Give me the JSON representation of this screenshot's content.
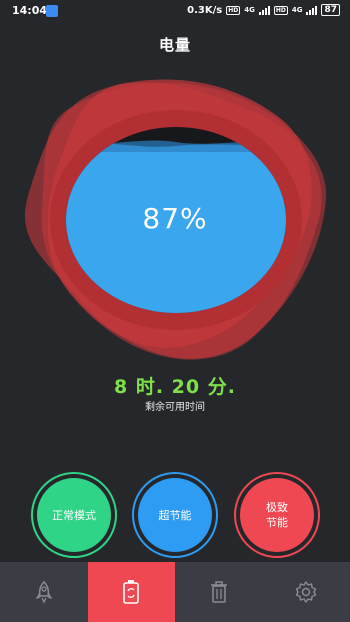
{
  "status_bar": {
    "time": "14:04",
    "speed": "0.3K/s",
    "network_1": "4G",
    "network_2": "4G",
    "hd_1": "HD",
    "hd_2": "HD",
    "battery": "87",
    "app_icon": "paper-plane-icon"
  },
  "header": {
    "title": "电量"
  },
  "battery": {
    "percent_text": "87%",
    "level": 0.87,
    "remaining_time": "8 时. 20 分.",
    "remaining_label": "剩余可用时间"
  },
  "modes": [
    {
      "label": "正常模式",
      "color": "#2fd487"
    },
    {
      "label": "超节能",
      "color": "#2e9cf2"
    },
    {
      "label": "极致\n节能",
      "color": "#ef4852"
    }
  ],
  "nav": {
    "active_index": 1,
    "tabs": [
      "rocket-icon",
      "battery-icon",
      "trash-icon",
      "gear-icon"
    ]
  },
  "colors": {
    "background": "#26272b",
    "blob": "#c7393c",
    "water": "#3aa6ee",
    "accent_green": "#7ee04a",
    "nav_bg": "#3a3d44"
  }
}
